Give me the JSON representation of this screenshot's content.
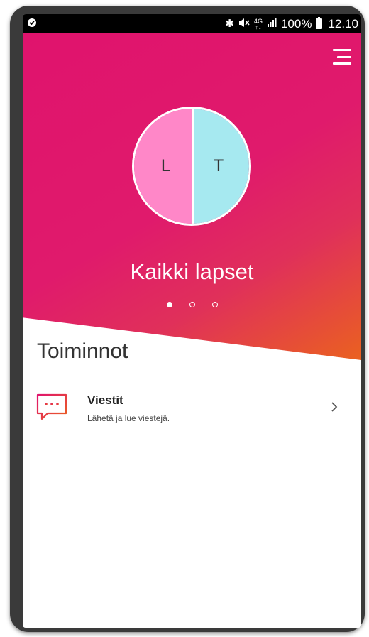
{
  "status_bar": {
    "left_icon": "app-notification-icon",
    "network_top": "4G",
    "network_bottom": "↑↓",
    "battery_percent": "100%",
    "time": "12.10"
  },
  "header": {
    "menu_icon": "hamburger-menu-icon"
  },
  "hero": {
    "avatar_left_letter": "L",
    "avatar_right_letter": "T",
    "avatar_left_color": "#ff87c8",
    "avatar_right_color": "#a6e9f0",
    "title": "Kaikki lapset",
    "pager_total": 3,
    "pager_active_index": 0
  },
  "main": {
    "section_title": "Toiminnot",
    "items": [
      {
        "icon": "message-bubble-icon",
        "title": "Viestit",
        "subtitle": "Lähetä ja lue viestejä."
      }
    ]
  },
  "colors": {
    "gradient_start": "#e0136d",
    "gradient_end": "#ea6120",
    "icon_accent": "#e0436a"
  }
}
